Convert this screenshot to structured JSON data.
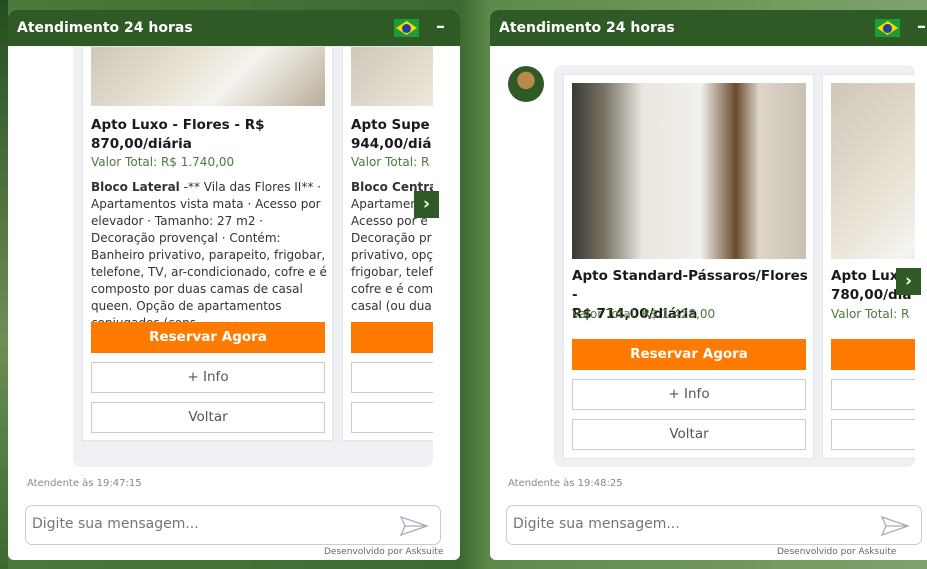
{
  "left": {
    "header_title": "Atendimento 24 horas",
    "timestamp": "Atendente às 19:47:15",
    "cards": [
      {
        "title": "Apto Luxo - Flores - R$\n870,00/diária",
        "total": "Valor Total: R$ 1.740,00",
        "desc_bold": "Bloco Lateral",
        "desc": " -** Vila das Flores II** · Apartamentos vista mata · Acesso por elevador · Tamanho: 27 m2 · Decoração provençal · Contém: Banheiro privativo, parapeito, frigobar, telefone, TV, ar-condicionado, cofre e é composto por duas camas de casal queen. Opção de apartamentos conjugados (cons...",
        "reserve": "Reservar Agora",
        "info": "+ Info",
        "back": "Voltar"
      },
      {
        "title": "Apto Supe\n944,00/diá",
        "total": "Valor Total: R",
        "desc_bold": "Bloco Centra",
        "desc": "\nApartamen\nAcesso por e\nDecoração pr\nprivativo, opç\nfrigobar, telef\ncofre e é com\ncasal (ou dua",
        "reserve": "Re",
        "info": "",
        "back": ""
      }
    ]
  },
  "right": {
    "header_title": "Atendimento 24 horas",
    "timestamp": "Atendente às 19:48:25",
    "cards": [
      {
        "title": "Apto Standard-Pássaros/Flores -\nR$ 714,00/diária",
        "total": "Valor Total: R$ 1.428,00",
        "reserve": "Reservar Agora",
        "info": "+ Info",
        "back": "Voltar"
      },
      {
        "title": "Apto Lux\n780,00/dia",
        "total": "Valor Total: R",
        "reserve": "R",
        "info": "",
        "back": ""
      }
    ]
  },
  "input_placeholder": "Digite sua mensagem...",
  "footer": "Desenvolvido por Asksuite",
  "icons": {
    "flag": "brazil-flag-icon",
    "minimize": "minimize-icon",
    "next": "chevron-right-icon",
    "send": "send-icon"
  },
  "colors": {
    "header": "#2f5a26",
    "reserve": "#ff7a00",
    "total": "#4d7a3f"
  }
}
